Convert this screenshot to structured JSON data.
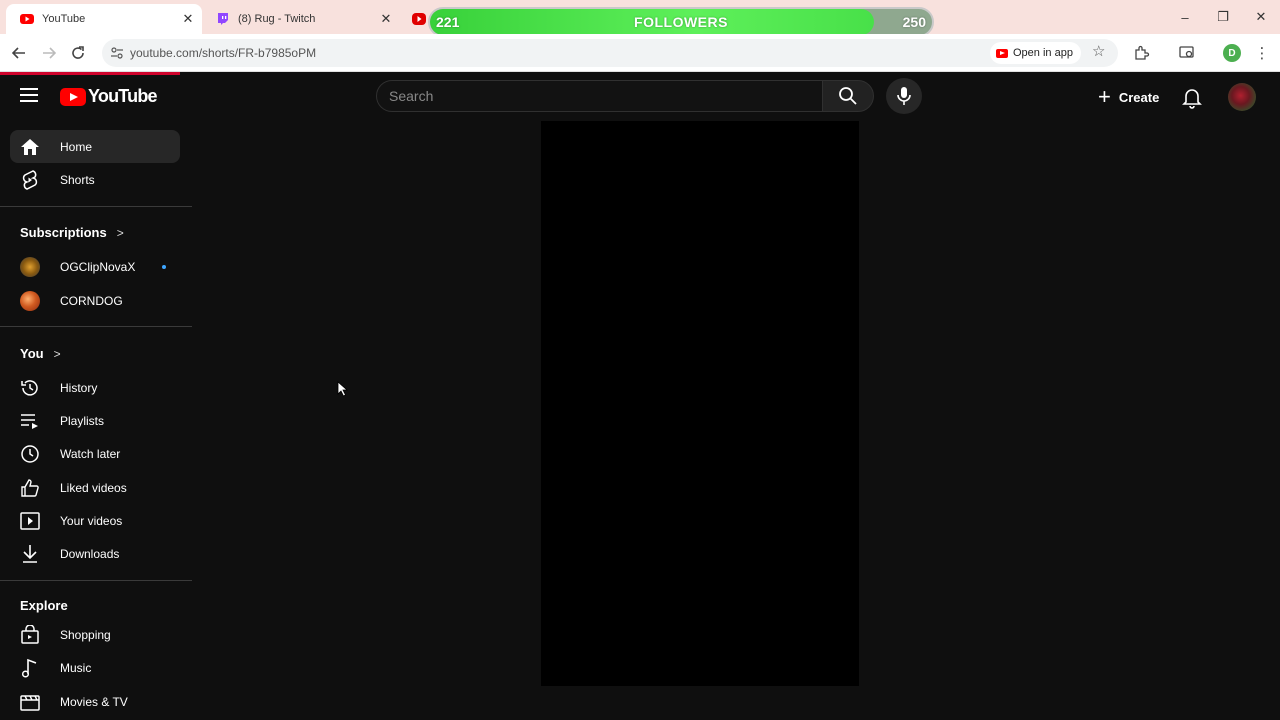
{
  "browser": {
    "tabs": [
      {
        "label": "YouTube",
        "icon": "youtube-favicon",
        "active": true
      },
      {
        "label": "(8) Rug - Twitch",
        "icon": "twitch-favicon",
        "active": false
      },
      {
        "label": "",
        "icon": "youtube-favicon",
        "active": false
      }
    ],
    "url": "youtube.com/shorts/FR-b7985oPM",
    "open_in_app_label": "Open in app",
    "profile_initial": "D"
  },
  "follower_goal": {
    "label": "FOLLOWERS",
    "current": "221",
    "target": "250",
    "progress_fraction": 0.884
  },
  "youtube": {
    "logo_text": "YouTube",
    "search": {
      "placeholder": "Search",
      "value": ""
    },
    "create_label": "Create"
  },
  "sidebar": {
    "main": [
      {
        "label": "Home",
        "icon": "home-icon",
        "selected": true
      },
      {
        "label": "Shorts",
        "icon": "shorts-icon",
        "selected": false
      }
    ],
    "subscriptions_title": "Subscriptions",
    "subscriptions": [
      {
        "label": "OGClipNovaX",
        "icon": "channel-avatar",
        "new_content": true
      },
      {
        "label": "CORNDOG",
        "icon": "channel-avatar",
        "new_content": false
      }
    ],
    "you_title": "You",
    "you": [
      {
        "label": "History",
        "icon": "history-icon"
      },
      {
        "label": "Playlists",
        "icon": "playlists-icon"
      },
      {
        "label": "Watch later",
        "icon": "watch-later-icon"
      },
      {
        "label": "Liked videos",
        "icon": "like-icon"
      },
      {
        "label": "Your videos",
        "icon": "your-videos-icon"
      },
      {
        "label": "Downloads",
        "icon": "download-icon"
      }
    ],
    "explore_title": "Explore",
    "explore": [
      {
        "label": "Shopping",
        "icon": "shopping-icon"
      },
      {
        "label": "Music",
        "icon": "music-icon"
      },
      {
        "label": "Movies & TV",
        "icon": "movies-icon"
      }
    ]
  },
  "colors": {
    "background": "#0f0f0f",
    "accent": "#ff0000",
    "tabbar": "#f8e1dd",
    "goal_fill": "#48e049"
  }
}
